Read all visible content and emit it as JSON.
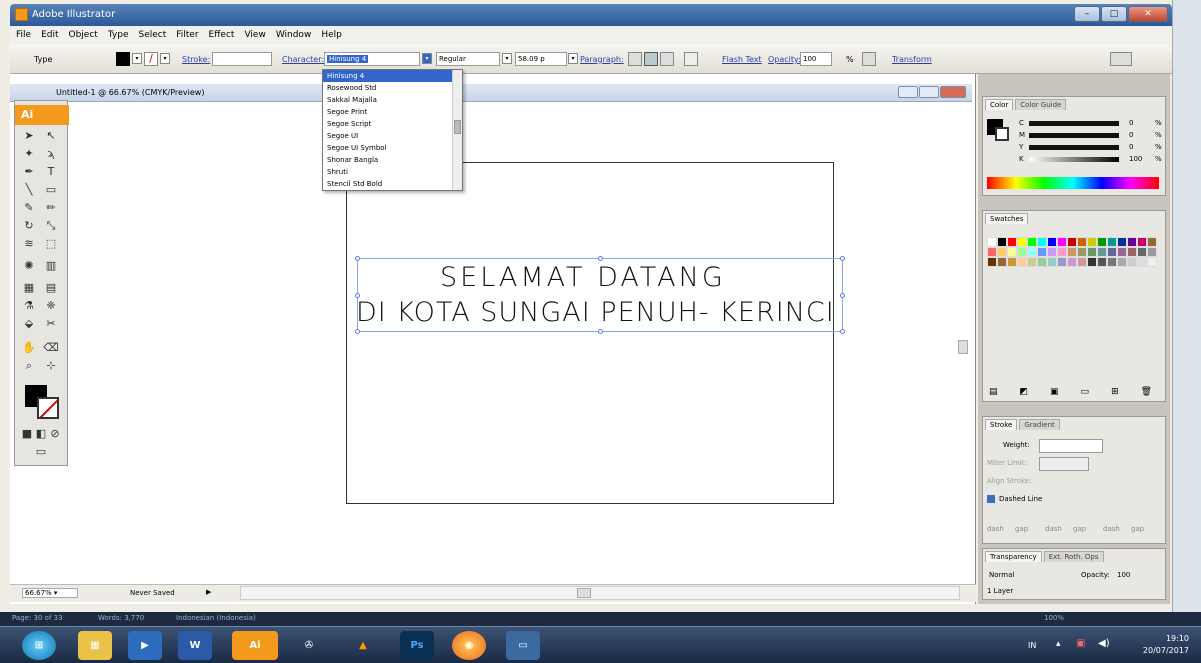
{
  "window": {
    "title": "Adobe Illustrator"
  },
  "menu": [
    "File",
    "Edit",
    "Object",
    "Type",
    "Select",
    "Filter",
    "Effect",
    "View",
    "Window",
    "Help"
  ],
  "control": {
    "tool_label": "Type",
    "stroke_label": "Stroke:",
    "character_label": "Character:",
    "font_value": "Hinisung 4",
    "style_value": "Regular",
    "size_value": "58.09 p",
    "paragraph_label": "Paragraph:",
    "flash_text": "Flash Text",
    "opacity_label": "Opacity:",
    "opacity_value": "100",
    "opacity_unit": "%",
    "transform": "Transform"
  },
  "document": {
    "tab_title": "Untitled-1 @ 66.67% (CMYK/Preview)",
    "ai_badge": "Ai"
  },
  "font_dropdown": {
    "items": [
      "Hinisung 4",
      "Rosewood Std",
      "Sakkal Majalla",
      "Segoe Print",
      "Segoe Script",
      "Segoe UI",
      "Segoe UI Symbol",
      "Shonar Bangla",
      "Shruti",
      "Stencil Std Bold"
    ],
    "selected_index": 0
  },
  "artwork": {
    "line1": "SELAMAT DATANG",
    "line2": "DI KOTA SUNGAI PENUH- KERINCI"
  },
  "status": {
    "zoom": "66.67%",
    "save_state": "Never Saved"
  },
  "panels": {
    "color": {
      "tab": "Color",
      "tab2": "Color Guide",
      "channels": [
        {
          "label": "C",
          "value": "0"
        },
        {
          "label": "M",
          "value": "0"
        },
        {
          "label": "Y",
          "value": "0"
        },
        {
          "label": "K",
          "value": "100"
        }
      ],
      "unit": "%"
    },
    "swatches": {
      "tab": "Swatches"
    },
    "stroke": {
      "tab": "Stroke",
      "tab2": "Gradient",
      "weight_label": "Weight:",
      "miter_label": "Miter Limit:",
      "align_label": "Align Stroke:",
      "dashed_label": "Dashed Line",
      "dash_fields": [
        "dash",
        "gap",
        "dash",
        "gap",
        "dash",
        "gap"
      ]
    },
    "transparency": {
      "tab": "Transparency",
      "tab2": "Ext. Roth. Ops",
      "mode": "Normal",
      "opacity_label": "Opacity:",
      "opacity_value": "100",
      "layer": "1 Layer"
    }
  },
  "word_status": {
    "page": "Page: 30 of 33",
    "words": "Words: 3,770",
    "language": "Indonesian (Indonesia)",
    "zoom": "100%"
  },
  "taskbar": {
    "lang": "IN",
    "time": "19:10",
    "date": "20/07/2017",
    "ai_label": "Ai",
    "ps_label": "Ps"
  },
  "colors": {
    "accent_orange": "#f39a1d",
    "title_blue": "#3b6aa6",
    "select_blue": "#3366cc"
  }
}
